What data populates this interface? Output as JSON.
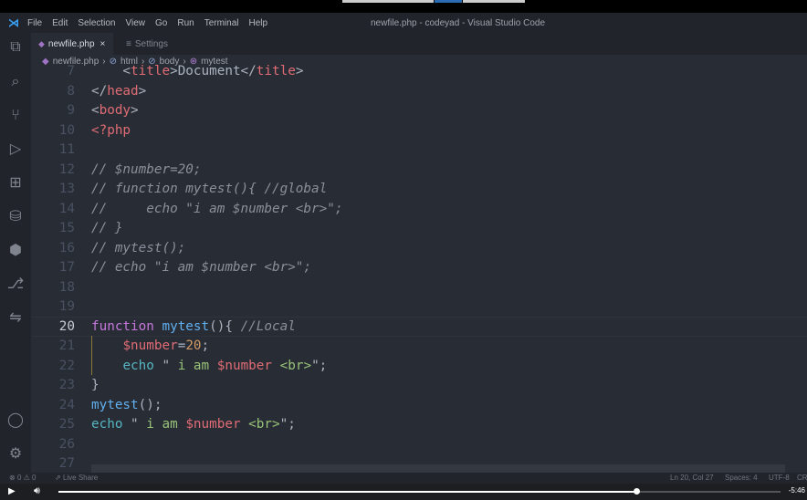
{
  "window": {
    "title": "newfile.php - codeyad - Visual Studio Code"
  },
  "menu": [
    "File",
    "Edit",
    "Selection",
    "View",
    "Go",
    "Run",
    "Terminal",
    "Help"
  ],
  "activity_icons": [
    "files-icon",
    "search-icon",
    "source-control-icon",
    "run-debug-icon",
    "extensions-icon",
    "database-icon",
    "package-icon",
    "git-graph-icon",
    "remote-icon"
  ],
  "tabs": [
    {
      "label": "newfile.php",
      "active": true
    },
    {
      "label": "Settings",
      "active": false
    }
  ],
  "breadcrumb": [
    "newfile.php",
    "html",
    "body",
    "mytest"
  ],
  "code": [
    {
      "n": "7",
      "t": [
        [
          "pu",
          "    <"
        ],
        [
          "tag",
          "title"
        ],
        [
          "pu",
          ">Document</"
        ],
        [
          "tag",
          "title"
        ],
        [
          "pu",
          ">"
        ]
      ]
    },
    {
      "n": "8",
      "t": [
        [
          "pu",
          "</"
        ],
        [
          "tag",
          "head"
        ],
        [
          "pu",
          ">"
        ]
      ]
    },
    {
      "n": "9",
      "t": [
        [
          "pu",
          "<"
        ],
        [
          "tag",
          "body"
        ],
        [
          "pu",
          ">"
        ]
      ]
    },
    {
      "n": "10",
      "t": [
        [
          "tag",
          "<?php"
        ]
      ]
    },
    {
      "n": "11",
      "t": []
    },
    {
      "n": "12",
      "t": [
        [
          "cm",
          "// $number=20;"
        ]
      ]
    },
    {
      "n": "13",
      "t": [
        [
          "cm",
          "// function mytest(){ //global"
        ]
      ]
    },
    {
      "n": "14",
      "t": [
        [
          "cm",
          "//     echo \"i am $number <br>\";"
        ]
      ]
    },
    {
      "n": "15",
      "t": [
        [
          "cm",
          "// }"
        ]
      ]
    },
    {
      "n": "16",
      "t": [
        [
          "cm",
          "// mytest();"
        ]
      ]
    },
    {
      "n": "17",
      "t": [
        [
          "cm",
          "// echo \"i am $number <br>\";"
        ]
      ]
    },
    {
      "n": "18",
      "t": []
    },
    {
      "n": "19",
      "t": []
    },
    {
      "n": "20",
      "t": [
        [
          "kw",
          "function"
        ],
        [
          "pu",
          " "
        ],
        [
          "fn",
          "mytest"
        ],
        [
          "pu",
          "(){ "
        ],
        [
          "cm",
          "//Local"
        ]
      ]
    },
    {
      "n": "21",
      "t": [
        [
          "pu",
          "    "
        ],
        [
          "var",
          "$number"
        ],
        [
          "pu",
          "="
        ],
        [
          "num",
          "20"
        ],
        [
          "pu",
          ";"
        ]
      ]
    },
    {
      "n": "22",
      "t": [
        [
          "pu",
          "    "
        ],
        [
          "ech",
          "echo"
        ],
        [
          "pu",
          " \""
        ],
        [
          "str",
          " i am "
        ],
        [
          "var",
          "$number"
        ],
        [
          "str",
          " <br>"
        ],
        [
          "pu",
          "\";"
        ]
      ]
    },
    {
      "n": "23",
      "t": [
        [
          "pu",
          "}"
        ]
      ]
    },
    {
      "n": "24",
      "t": [
        [
          "fn",
          "mytest"
        ],
        [
          "pu",
          "();"
        ]
      ]
    },
    {
      "n": "25",
      "t": [
        [
          "ech",
          "echo"
        ],
        [
          "pu",
          " \""
        ],
        [
          "str",
          " i am "
        ],
        [
          "var",
          "$number"
        ],
        [
          "str",
          " <br>"
        ],
        [
          "pu",
          "\";"
        ]
      ]
    },
    {
      "n": "26",
      "t": []
    },
    {
      "n": "27",
      "t": []
    }
  ],
  "current_line": "20",
  "status": {
    "errors": "0",
    "warnings": "0",
    "live_share": "Live Share",
    "position": "Ln 20, Col 27",
    "spaces": "Spaces: 4",
    "encoding": "UTF-8",
    "eol": "CR"
  },
  "video": {
    "progress": 0.8,
    "time_remaining": "-5:46"
  }
}
